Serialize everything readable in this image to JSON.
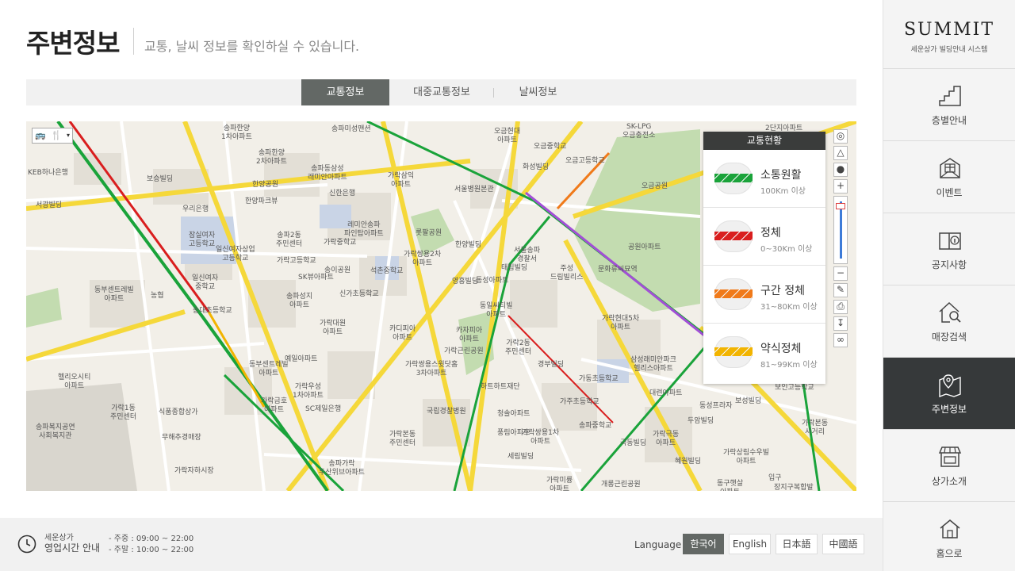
{
  "header": {
    "title": "주변정보",
    "subtitle": "교통, 날씨 정보를 확인하실 수 있습니다."
  },
  "tabs": [
    {
      "label": "교통정보",
      "active": true
    },
    {
      "label": "대중교통정보",
      "active": false
    },
    {
      "label": "날씨정보",
      "active": false
    }
  ],
  "map": {
    "labels": {
      "l1": "송파한양\n1차아파트",
      "l2": "송파미성맨션",
      "l3": "오금현대\n아파트",
      "l4": "SK-LPG\n오금충전소",
      "l5": "2단지아파트",
      "l6": "KEB하나은행",
      "l7": "송파한양\n2차아파트",
      "l8": "송파동삼성\n래미안아파트",
      "l9": "오금중학교",
      "l10": "오금고등학교",
      "l11": "보승빌딩",
      "l12": "화성빌딩",
      "l13": "한양공원",
      "l14": "신한은행",
      "l15": "가락삼익\n아파트",
      "l16": "서울병원본관",
      "l17": "서광빌딩",
      "l18": "우리은행",
      "l19": "한양파크뷰",
      "l20": "오금공원",
      "l21": "잠실여자\n고등학교",
      "l22": "레미안송파\n파인탑아파트",
      "l23": "롯팔공원",
      "l24": "송파2동\n주민센터",
      "l25": "일신여자상업\n고등학교",
      "l26": "가락중학교",
      "l27": "가락쌍용2차\n아파트",
      "l28": "한양빌딩",
      "l29": "서울송파\n경찰서",
      "l30": "공원아파트",
      "l31": "가락고등학교",
      "l32": "송이공원",
      "l33": "석촌중학교",
      "l34": "SK뷰아파트",
      "l35": "태림빌딩",
      "l36": "문화류씨묘역",
      "l37": "일신여자\n중학교",
      "l38": "영흥빌딩",
      "l39": "동성아파트",
      "l40": "주성\n드림빌리스",
      "l41": "동부센트레빌\n아파트",
      "l42": "송파성지\n아파트",
      "l43": "신가초등학교",
      "l44": "동일씨티빌\n아파트",
      "l45": "농협",
      "l46": "송대초등학교",
      "l47": "가락대원\n아파트",
      "l48": "카디피아\n아파트",
      "l49": "카자피아\n아파트",
      "l50": "가락현대5차\n아파트",
      "l51": "가락2동\n주민센터",
      "l52": "가락근린공원",
      "l53": "삼성래미안파크\n헬리스아파트",
      "l54": "동부센트레빌\n아파트",
      "l55": "예일아파트",
      "l56": "경부빌딩",
      "l57": "헬리오시티\n아파트",
      "l58": "가락쌍용스윗닷홈\n3차아파트",
      "l59": "가동초등학교",
      "l60": "가락우성\n1차아파트",
      "l61": "하트하트재단",
      "l62": "대련아파트",
      "l63": "보인고등학교",
      "l64": "가락1동\n주민센터",
      "l65": "가락금호\n아파트",
      "l66": "SC제일은행",
      "l67": "국립경찰병원",
      "l68": "청솔아파트",
      "l69": "가주초등학교",
      "l70": "보성빌딩",
      "l71": "송파복지공연\n사회복지관",
      "l72": "식품종합상가",
      "l73": "동성프라자",
      "l74": "송파중학교",
      "l75": "가락본동\n주민센터",
      "l76": "풍림아파트",
      "l77": "가락쌍용1차\n아파트",
      "l78": "극동빌딩",
      "l79": "가락극동\n아파트",
      "l80": "무해추경매장",
      "l81": "두암빌딩",
      "l82": "가락상림수우빌\n아파트",
      "l83": "세림빌딩",
      "l84": "송파가락\n두산위브아파트",
      "l85": "혜원빌딩",
      "l86": "가락자하시장",
      "l87": "가락미륭\n아파트",
      "l88": "개롱근린공원",
      "l89": "동구햇살\n아파트",
      "l90": "입구",
      "l91": "장지구복합발",
      "l92": "가락본동\n사거리"
    }
  },
  "legend": {
    "title": "교통현황",
    "items": [
      {
        "name": "소통원활",
        "range": "100Km 이상",
        "color": "#1aa33a"
      },
      {
        "name": "정체",
        "range": "0~30Km 이상",
        "color": "#d91e1e"
      },
      {
        "name": "구간 정체",
        "range": "31~80Km 이상",
        "color": "#f07a1a"
      },
      {
        "name": "약식정체",
        "range": "81~99Km 이상",
        "color": "#f2b400"
      }
    ]
  },
  "footer": {
    "hours_title_small": "세운상가",
    "hours_title_big": "영업시간 안내",
    "weekday": "- 주중 : 09:00 ~ 22:00",
    "weekend": "- 주말 : 10:00 ~ 22:00",
    "language_label": "Language",
    "languages": [
      {
        "label": "한국어",
        "active": true
      },
      {
        "label": "English",
        "active": false
      },
      {
        "label": "日本語",
        "active": false
      },
      {
        "label": "中國語",
        "active": false
      }
    ]
  },
  "sidebar": {
    "brand": "SUMMIT",
    "brand_sub": "세운상가 빌딩안내 시스템",
    "items": [
      {
        "label": "층별안내",
        "icon": "stairs-icon",
        "active": false
      },
      {
        "label": "이벤트",
        "icon": "gift-envelope-icon",
        "active": false
      },
      {
        "label": "공지사항",
        "icon": "book-info-icon",
        "active": false
      },
      {
        "label": "매장검색",
        "icon": "house-search-icon",
        "active": false
      },
      {
        "label": "주변정보",
        "icon": "map-pin-icon",
        "active": true
      },
      {
        "label": "상가소개",
        "icon": "storefront-icon",
        "active": false
      },
      {
        "label": "홈으로",
        "icon": "home-icon",
        "active": false
      }
    ]
  },
  "colors": {
    "accent_dark": "#36393a",
    "tab_active": "#636865",
    "traffic_green": "#1aa33a",
    "traffic_red": "#d91e1e",
    "traffic_orange": "#f07a1a",
    "traffic_yellow": "#f2b400"
  }
}
